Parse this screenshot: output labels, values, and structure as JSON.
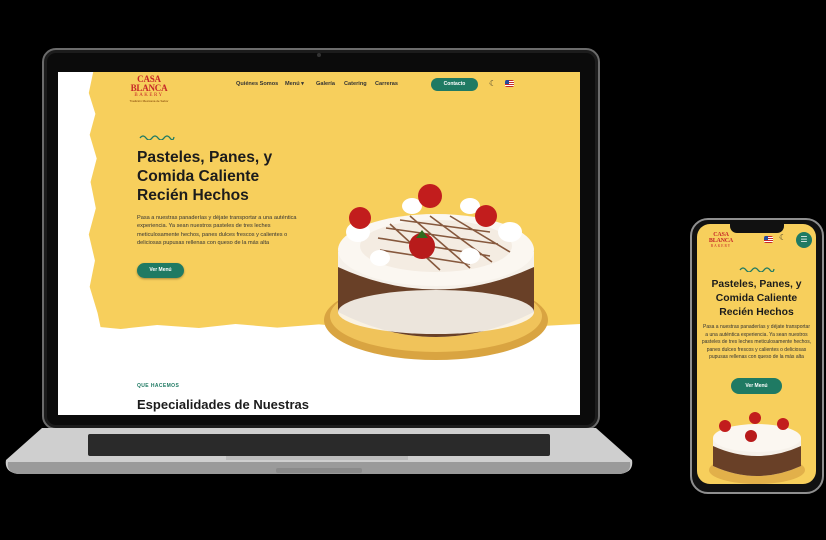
{
  "laptop": {
    "logo": {
      "main": "CASA BLANCA",
      "sub": "BAKERY",
      "tagline": "Tradición Mexicana de Sabor"
    },
    "nav": {
      "items": [
        "Quiénes Somos",
        "Menú ▾",
        "Galería",
        "Catering",
        "Carreras"
      ],
      "contact_button": "Contacto",
      "theme_toggle": "☾"
    },
    "hero": {
      "title_lines": [
        "Pasteles, Panes, y",
        "Comida Caliente",
        "Recién Hechos"
      ],
      "text": "Pasa a nuestras panaderías y déjate transportar a una auténtica experiencia. Ya sean nuestros pasteles de tres leches meticulosamente hechos, panes dulces frescos y calientes o deliciosas pupusas rellenas con queso de la más alta",
      "button": "Ver Menú"
    },
    "section": {
      "label": "QUE HACEMOS",
      "title": "Especialidades de Nuestras"
    }
  },
  "phone": {
    "logo": {
      "main": "CASA BLANCA",
      "sub": "BAKERY"
    },
    "theme_toggle": "☾",
    "menu_icon": "☰",
    "hero": {
      "title_lines": [
        "Pasteles, Panes, y",
        "Comida Caliente",
        "Recién Hechos"
      ],
      "text": "Pasa a nuestras panaderías y déjate transportar a una auténtica experiencia. Ya sean nuestros pasteles de tres leches meticulosamente hechos, panes dulces frescos y calientes o deliciosas pupusas rellenas con queso de la más alta",
      "button": "Ver Menú"
    }
  },
  "colors": {
    "hero_background": "#f7cf5c",
    "accent_green": "#1f7a63",
    "logo_red": "#c62828"
  }
}
